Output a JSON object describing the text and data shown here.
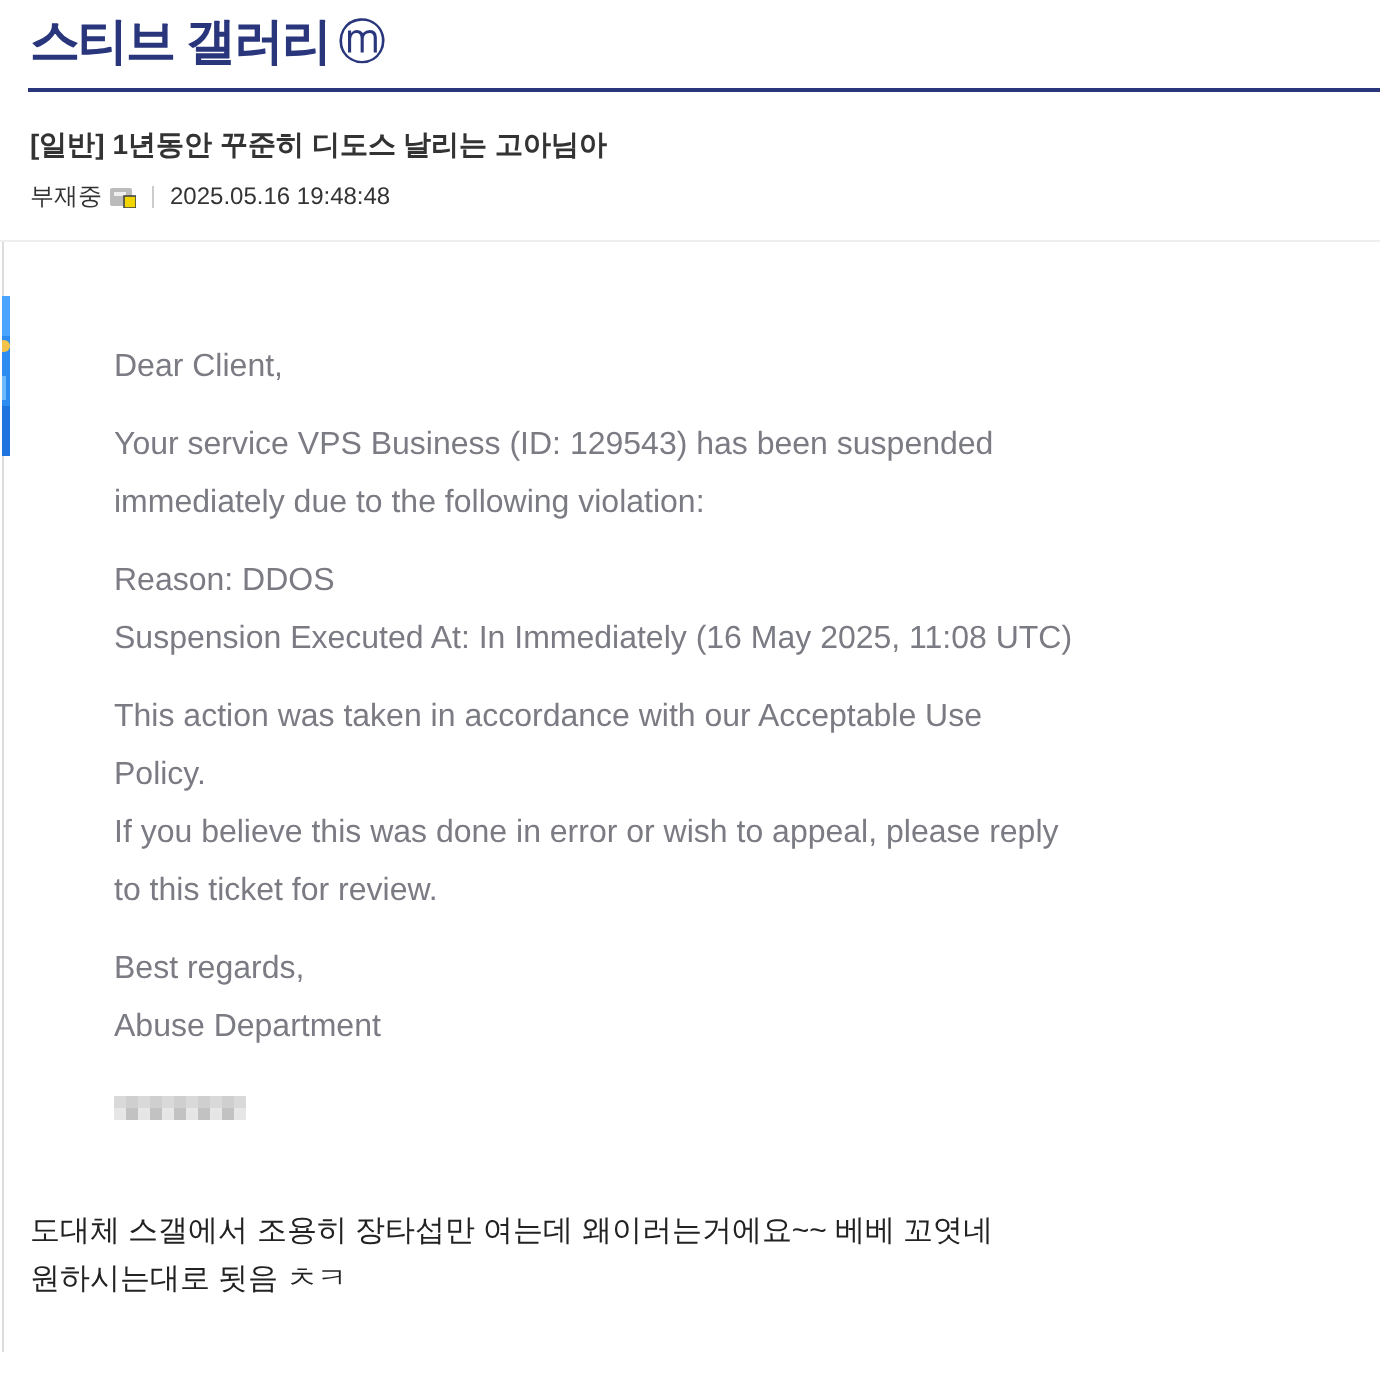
{
  "gallery": {
    "title": "스티브 갤러리",
    "badge": "ⓜ"
  },
  "post": {
    "title": "[일반] 1년동안 꾸준히 디도스 날리는 고아님아",
    "author": "부재중",
    "date": "2025.05.16 19:48:48"
  },
  "email": {
    "paragraphs": [
      [
        "Dear Client,"
      ],
      [
        "Your service VPS Business (ID: 129543) has been suspended",
        "immediately due to the following violation:"
      ],
      [
        "Reason: DDOS",
        "Suspension Executed At: In Immediately (16 May 2025, 11:08 UTC)"
      ],
      [
        "This action was taken in accordance with our Acceptable Use",
        "Policy.",
        "If you believe this was done in error or wish to appeal, please reply",
        "to this ticket for review."
      ],
      [
        "Best regards,",
        "Abuse Department"
      ]
    ],
    "redacted": true
  },
  "body": [
    "도대체 스갤에서 조용히 장타섭만 여는데 왜이러는거에요~~ 베베 꼬엿네",
    "원하시는대로 됫음 ㅊㅋ"
  ]
}
